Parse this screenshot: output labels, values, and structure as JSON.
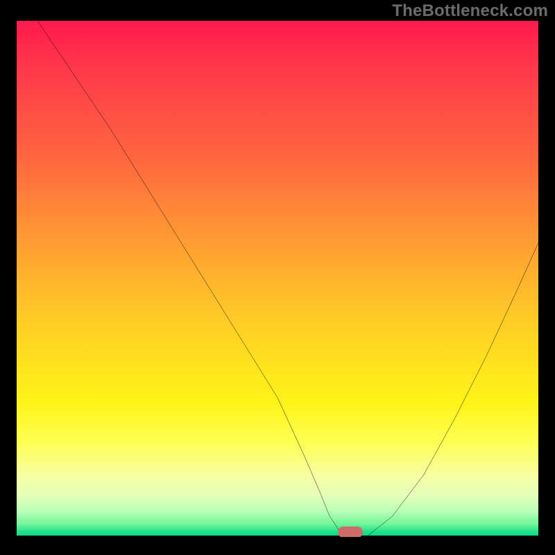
{
  "watermark": "TheBottleneck.com",
  "colors": {
    "frame": "#000000",
    "watermark_text": "#6b6b6b",
    "curve_stroke": "#000000",
    "marker_fill": "#cf6a6a",
    "gradient_stops": [
      "#ff1a4d",
      "#ff3a4a",
      "#ff6a3e",
      "#ff9a33",
      "#ffc328",
      "#ffe11e",
      "#fff318",
      "#feff57",
      "#f6ffa0",
      "#e6ffba",
      "#b9ffb4",
      "#72f59a",
      "#1fe08a",
      "#0cd47e"
    ]
  },
  "chart_data": {
    "type": "line",
    "title": "",
    "xlabel": "",
    "ylabel": "",
    "xlim": [
      0,
      100
    ],
    "ylim": [
      0,
      100
    ],
    "grid": false,
    "legend": false,
    "x": [
      4,
      10,
      18,
      26,
      34,
      42,
      50,
      55,
      58,
      60,
      62,
      64,
      67,
      72,
      78,
      84,
      90,
      96,
      100
    ],
    "values": [
      100,
      91,
      79,
      66,
      53,
      40,
      27,
      16,
      9,
      4,
      1,
      0,
      0,
      4,
      12,
      23,
      35,
      48,
      57
    ],
    "marker": {
      "x": 64,
      "y": 0
    },
    "notes": "V-shaped bottleneck curve. Left branch is steeper than right. Minimum (optimal point) near x≈64% where curve touches y=0. Values are percentages read from a unitless 0–100 plot area; no axis tick labels are shown."
  }
}
